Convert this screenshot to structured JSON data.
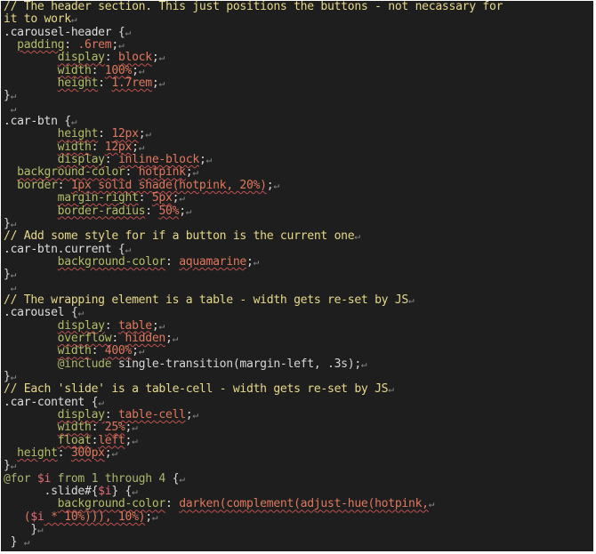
{
  "mark": "↵",
  "lines": [
    [
      [
        "c",
        "// The header section. This just positions the buttons - not necassary for"
      ]
    ],
    [
      [
        "c",
        "it to work"
      ],
      [
        "m",
        "↵"
      ]
    ],
    [
      [
        "s",
        ".carousel-header "
      ],
      [
        "x",
        "{"
      ],
      [
        "m",
        "↵"
      ]
    ],
    [
      [
        "x",
        "  "
      ],
      [
        "p",
        "padding"
      ],
      [
        "x",
        ": "
      ],
      [
        "v",
        ".6rem"
      ],
      [
        "x",
        ";"
      ],
      [
        "m",
        "↵"
      ]
    ],
    [
      [
        "x",
        "        "
      ],
      [
        "p",
        "display"
      ],
      [
        "x",
        ": "
      ],
      [
        "v",
        "block"
      ],
      [
        "x",
        ";"
      ],
      [
        "m",
        "↵"
      ]
    ],
    [
      [
        "x",
        "        "
      ],
      [
        "p",
        "width"
      ],
      [
        "x",
        ": "
      ],
      [
        "v",
        "100%"
      ],
      [
        "x",
        ";"
      ],
      [
        "m",
        "↵"
      ]
    ],
    [
      [
        "x",
        "        "
      ],
      [
        "p",
        "height"
      ],
      [
        "x",
        ": "
      ],
      [
        "v",
        "1.7rem"
      ],
      [
        "x",
        ";"
      ],
      [
        "m",
        "↵"
      ]
    ],
    [
      [
        "x",
        "}"
      ],
      [
        "m",
        "↵"
      ]
    ],
    [
      [
        "x",
        " "
      ],
      [
        "m",
        "↵"
      ]
    ],
    [
      [
        "s",
        ".car-btn "
      ],
      [
        "x",
        "{"
      ],
      [
        "m",
        "↵"
      ]
    ],
    [
      [
        "x",
        "        "
      ],
      [
        "p",
        "height"
      ],
      [
        "x",
        ": "
      ],
      [
        "v",
        "12px"
      ],
      [
        "x",
        ";"
      ],
      [
        "m",
        "↵"
      ]
    ],
    [
      [
        "x",
        "        "
      ],
      [
        "p",
        "width"
      ],
      [
        "x",
        ": "
      ],
      [
        "v",
        "12px"
      ],
      [
        "x",
        ";"
      ],
      [
        "m",
        "↵"
      ]
    ],
    [
      [
        "x",
        "        "
      ],
      [
        "p",
        "display"
      ],
      [
        "x",
        ": "
      ],
      [
        "v",
        "inline-block"
      ],
      [
        "x",
        ";"
      ],
      [
        "m",
        "↵"
      ]
    ],
    [
      [
        "x",
        "  "
      ],
      [
        "p",
        "background-color"
      ],
      [
        "x",
        ": "
      ],
      [
        "v",
        "hotpink"
      ],
      [
        "x",
        ";"
      ],
      [
        "m",
        "↵"
      ]
    ],
    [
      [
        "x",
        "  "
      ],
      [
        "p",
        "border"
      ],
      [
        "x",
        ": "
      ],
      [
        "v",
        "1px solid shade(hotpink, 20%)"
      ],
      [
        "x",
        ";"
      ],
      [
        "m",
        "↵"
      ]
    ],
    [
      [
        "x",
        "        "
      ],
      [
        "p",
        "margin-right"
      ],
      [
        "x",
        ": "
      ],
      [
        "v",
        "5px"
      ],
      [
        "x",
        ";"
      ],
      [
        "m",
        "↵"
      ]
    ],
    [
      [
        "x",
        "        "
      ],
      [
        "p",
        "border-radius"
      ],
      [
        "x",
        ": "
      ],
      [
        "v",
        "50%"
      ],
      [
        "x",
        ";"
      ],
      [
        "m",
        "↵"
      ]
    ],
    [
      [
        "x",
        "}"
      ],
      [
        "m",
        "↵"
      ]
    ],
    [
      [
        "c",
        "// Add some style for if a button is the current one"
      ],
      [
        "m",
        "↵"
      ]
    ],
    [
      [
        "s",
        ".car-btn.current "
      ],
      [
        "x",
        "{"
      ],
      [
        "m",
        "↵"
      ]
    ],
    [
      [
        "x",
        "        "
      ],
      [
        "p",
        "background-color"
      ],
      [
        "x",
        ": "
      ],
      [
        "v",
        "aquamarine"
      ],
      [
        "x",
        ";"
      ],
      [
        "m",
        "↵"
      ]
    ],
    [
      [
        "x",
        "}"
      ],
      [
        "m",
        "↵"
      ]
    ],
    [
      [
        "x",
        " "
      ],
      [
        "m",
        "↵"
      ]
    ],
    [
      [
        "c",
        "// The wrapping element is a table - width gets re-set by JS"
      ],
      [
        "m",
        "↵"
      ]
    ],
    [
      [
        "s",
        ".carousel "
      ],
      [
        "x",
        "{"
      ],
      [
        "m",
        "↵"
      ]
    ],
    [
      [
        "x",
        "        "
      ],
      [
        "p",
        "display"
      ],
      [
        "x",
        ": "
      ],
      [
        "v",
        "table"
      ],
      [
        "x",
        ";"
      ],
      [
        "m",
        "↵"
      ]
    ],
    [
      [
        "x",
        "        "
      ],
      [
        "p",
        "overflow"
      ],
      [
        "x",
        ": "
      ],
      [
        "v",
        "hidden"
      ],
      [
        "x",
        ";"
      ],
      [
        "m",
        "↵"
      ]
    ],
    [
      [
        "x",
        "        "
      ],
      [
        "p",
        "width"
      ],
      [
        "x",
        ": "
      ],
      [
        "v",
        "400%"
      ],
      [
        "x",
        ";"
      ],
      [
        "m",
        "↵"
      ]
    ],
    [
      [
        "x",
        "        "
      ],
      [
        "k",
        "@include"
      ],
      [
        "x",
        " single-transition(margin-left, .3s);"
      ],
      [
        "m",
        "↵"
      ]
    ],
    [
      [
        "x",
        "}"
      ],
      [
        "m",
        "↵"
      ]
    ],
    [
      [
        "c",
        "// Each 'slide' is a table-cell - width gets re-set by JS"
      ],
      [
        "m",
        "↵"
      ]
    ],
    [
      [
        "s",
        ".car-content "
      ],
      [
        "x",
        "{"
      ],
      [
        "m",
        "↵"
      ]
    ],
    [
      [
        "x",
        "        "
      ],
      [
        "p",
        "display"
      ],
      [
        "x",
        ": "
      ],
      [
        "v",
        "table-cell"
      ],
      [
        "x",
        ";"
      ],
      [
        "m",
        "↵"
      ]
    ],
    [
      [
        "x",
        "        "
      ],
      [
        "p",
        "width"
      ],
      [
        "x",
        ": "
      ],
      [
        "v",
        "25%"
      ],
      [
        "x",
        ";"
      ],
      [
        "m",
        "↵"
      ]
    ],
    [
      [
        "x",
        "        "
      ],
      [
        "p",
        "float"
      ],
      [
        "x",
        ":"
      ],
      [
        "v",
        "left"
      ],
      [
        "x",
        ";"
      ],
      [
        "m",
        "↵"
      ]
    ],
    [
      [
        "x",
        "  "
      ],
      [
        "p",
        "height"
      ],
      [
        "x",
        ": "
      ],
      [
        "v",
        "300px"
      ],
      [
        "x",
        ";"
      ],
      [
        "m",
        "↵"
      ]
    ],
    [
      [
        "x",
        "}"
      ],
      [
        "m",
        "↵"
      ]
    ],
    [
      [
        "k",
        "@for "
      ],
      [
        "var",
        "$i"
      ],
      [
        "k",
        " from 1 through 4 "
      ],
      [
        "x",
        "{"
      ],
      [
        "m",
        "↵"
      ]
    ],
    [
      [
        "x",
        "      .slide#{"
      ],
      [
        "var",
        "$i"
      ],
      [
        "x",
        "} {"
      ],
      [
        "m",
        "↵"
      ]
    ],
    [
      [
        "x",
        "        "
      ],
      [
        "p",
        "background-color"
      ],
      [
        "x",
        ": "
      ],
      [
        "v",
        "darken(complement(adjust-hue(hotpink,"
      ],
      [
        "m",
        "↵"
      ]
    ],
    [
      [
        "v",
        "   ("
      ],
      [
        "var",
        "$i"
      ],
      [
        "v",
        " * 10%))), 10%)"
      ],
      [
        "x",
        ";"
      ],
      [
        "m",
        "↵"
      ]
    ],
    [
      [
        "x",
        "    }"
      ],
      [
        "m",
        "↵"
      ]
    ],
    [
      [
        "x",
        " } "
      ],
      [
        "m",
        "↵"
      ]
    ]
  ]
}
